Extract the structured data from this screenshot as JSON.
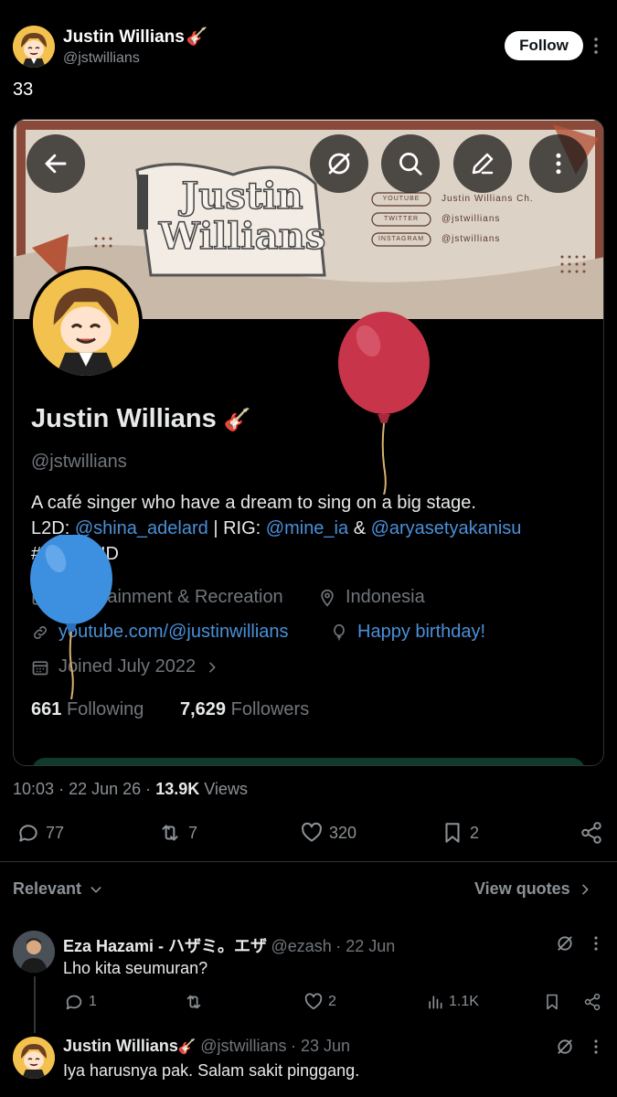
{
  "header": {
    "name": "Justin Willians",
    "name_emoji": "🎸",
    "handle": "@jstwillians",
    "follow_label": "Follow"
  },
  "tweet": {
    "text": "33"
  },
  "banner": {
    "logo_line1": "Justin",
    "logo_line2": "Willians",
    "rows": [
      {
        "platform": "YOUTUBE",
        "value": "Justin Willians Ch."
      },
      {
        "platform": "TWITTER",
        "value": "@jstwillians"
      },
      {
        "platform": "INSTAGRAM",
        "value": "@jstwillians"
      }
    ]
  },
  "profile": {
    "name": "Justin Willians",
    "name_emoji": "🎸",
    "handle": "@jstwillians",
    "bio_line1": "A café singer who have a dream to sing on a big stage.",
    "bio_l2d_label": "L2D:",
    "bio_l2d_handle": "@shina_adelard",
    "bio_sep": "| RIG:",
    "bio_rig_handle1": "@mine_ia",
    "bio_amp": "&",
    "bio_rig_handle2": "@aryasetyakanisu",
    "bio_hashtag": "#VTuberID",
    "category": "Entertainment & Recreation",
    "location": "Indonesia",
    "website": "youtube.com/@justinwillians",
    "birthday": "Happy birthday!",
    "joined": "Joined July 2022",
    "following_count": "661",
    "following_label": "Following",
    "followers_count": "7,629",
    "followers_label": "Followers"
  },
  "stats": {
    "time": "10:03",
    "date": "22 Jun 26",
    "views_count": "13.9K",
    "views_label": "Views",
    "replies": "77",
    "reposts": "7",
    "likes": "320",
    "bookmarks": "2"
  },
  "sort": {
    "label": "Relevant",
    "view_quotes": "View quotes"
  },
  "replies": [
    {
      "name": "Eza Hazami - ハザミ。エザ",
      "handle": "@ezash",
      "date": "· 22 Jun",
      "text": "Lho kita seumuran?",
      "replies": "1",
      "likes": "2",
      "views": "1.1K"
    },
    {
      "name": "Justin Willians",
      "name_emoji": "🎸",
      "handle": "@jstwillians",
      "date": "· 23 Jun",
      "text": "Iya harusnya pak. Salam sakit pinggang."
    }
  ],
  "colors": {
    "background": "#000000",
    "link": "#4a90d9",
    "muted": "#71767b",
    "banner_border": "#8a4a3a",
    "balloon_red": "#c8344a",
    "balloon_blue": "#3d8fe0"
  },
  "icons": [
    "back-arrow-icon",
    "grok-icon",
    "search-icon",
    "edit-icon",
    "more-vertical-icon",
    "briefcase-icon",
    "location-pin-icon",
    "link-icon",
    "balloon-icon",
    "calendar-icon",
    "chevron-right-icon",
    "reply-icon",
    "repost-icon",
    "heart-icon",
    "bookmark-icon",
    "share-icon",
    "chevron-down-icon",
    "analytics-icon"
  ]
}
